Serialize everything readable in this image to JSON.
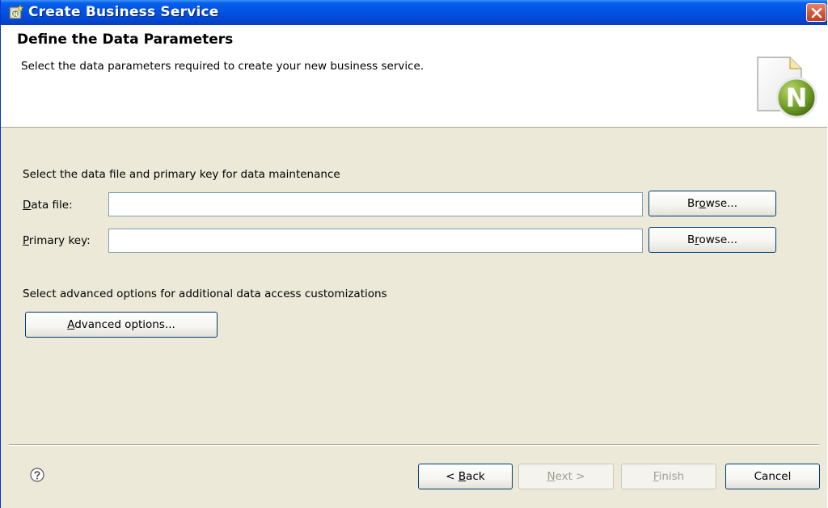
{
  "window": {
    "title": "Create Business Service",
    "app_icon": "wizard-app-icon",
    "close_icon": "close-icon"
  },
  "header": {
    "title": "Define the Data Parameters",
    "description": "Select the data parameters required to create your new business service.",
    "graphic": "document-n-icon",
    "graphic_letter": "N"
  },
  "data_section": {
    "heading": "Select the data file and primary key for data maintenance",
    "data_file": {
      "label_mn": "D",
      "label_rest": "ata file:",
      "value": "",
      "browse_pre": "Br",
      "browse_mn": "o",
      "browse_post": "wse..."
    },
    "primary_key": {
      "label_mn": "P",
      "label_rest": "rimary key:",
      "value": "",
      "browse_pre": "B",
      "browse_mn": "r",
      "browse_post": "owse..."
    }
  },
  "advanced_section": {
    "heading": "Select advanced options for additional data access customizations",
    "button_mn": "A",
    "button_rest": "dvanced options..."
  },
  "footer": {
    "help_icon": "help-icon",
    "back_pre": "< ",
    "back_mn": "B",
    "back_post": "ack",
    "next_mn": "N",
    "next_post": "ext >",
    "finish_mn": "F",
    "finish_post": "inish",
    "cancel": "Cancel"
  },
  "colors": {
    "titlebar": "#0055e5",
    "dialog_bg": "#ece9d8",
    "button_border": "#003c74",
    "disabled_text": "#a19e94",
    "close_button": "#d35a3e"
  }
}
